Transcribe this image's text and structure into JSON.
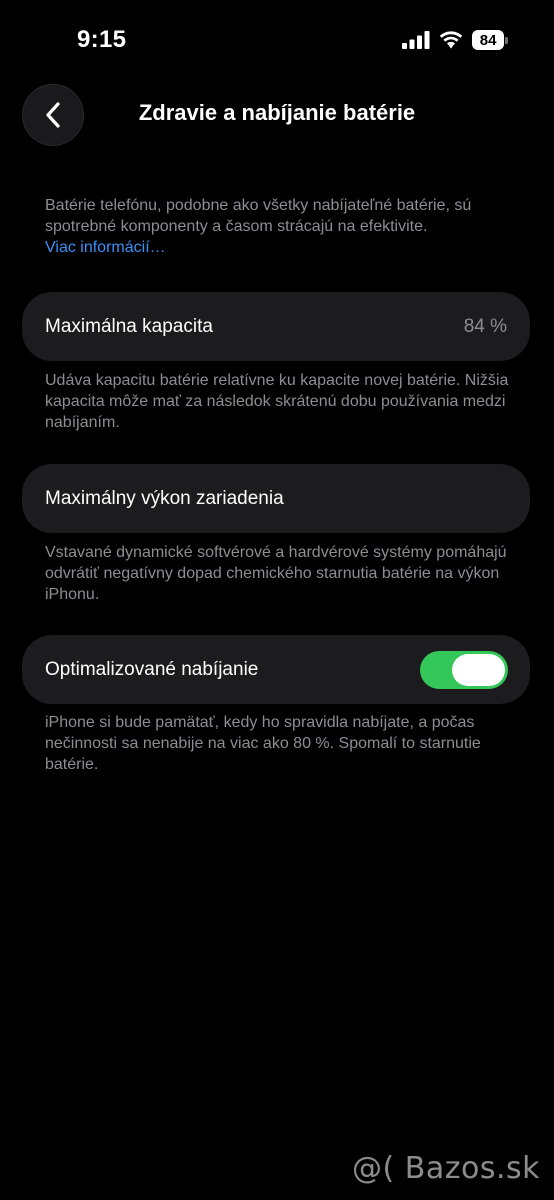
{
  "status_bar": {
    "time": "9:15",
    "battery_level": "84",
    "icons": [
      "signal-icon",
      "wifi-icon",
      "battery-icon"
    ]
  },
  "nav": {
    "back_icon": "chevron-left-icon",
    "title": "Zdravie a nabíjanie batérie"
  },
  "intro": {
    "text": "Batérie telefónu, podobne ako všetky nabíjateľné batérie, sú spotrebné komponenty a časom strácajú na efektivite.",
    "link": "Viac informácií…"
  },
  "max_capacity": {
    "label": "Maximálna kapacita",
    "value": "84 %",
    "footnote": "Udáva kapacitu batérie relatívne ku kapacite novej batérie. Nižšia kapacita môže mať za následok skrátenú dobu používania medzi nabíjaním."
  },
  "peak_performance": {
    "label": "Maximálny výkon zariadenia",
    "footnote": "Vstavané dynamické softvérové a hardvérové systémy pomáhajú odvrátiť negatívny dopad chemického starnutia batérie na výkon iPhonu."
  },
  "optimized_charging": {
    "label": "Optimalizované nabíjanie",
    "enabled": true,
    "footnote": "iPhone si bude pamätať, kedy ho spravidla nabíjate, a počas nečinnosti sa nenabije na viac ako 80 %. Spomalí to starnutie batérie."
  },
  "watermark": "@( Bazos.sk",
  "colors": {
    "background": "#000000",
    "cell": "#1c1c1e",
    "secondary_text": "#8d8d93",
    "link": "#3a8ff7",
    "toggle_on": "#34c759"
  }
}
